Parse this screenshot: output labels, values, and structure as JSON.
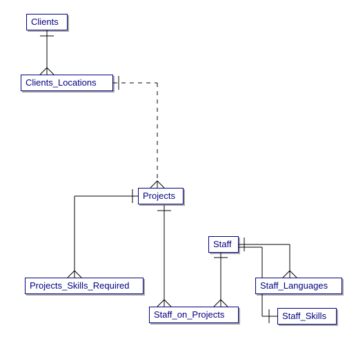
{
  "entities": {
    "clients": {
      "label": "Clients"
    },
    "clients_locations": {
      "label": "Clients_Locations"
    },
    "projects": {
      "label": "Projects"
    },
    "projects_skills_required": {
      "label": "Projects_Skills_Required"
    },
    "staff": {
      "label": "Staff"
    },
    "staff_on_projects": {
      "label": "Staff_on_Projects"
    },
    "staff_languages": {
      "label": "Staff_Languages"
    },
    "staff_skills": {
      "label": "Staff_Skills"
    }
  },
  "relationships": [
    {
      "from": "Clients",
      "to": "Clients_Locations",
      "type": "one-to-many"
    },
    {
      "from": "Clients_Locations",
      "to": "Projects",
      "type": "one-to-many",
      "style": "dashed"
    },
    {
      "from": "Projects",
      "to": "Projects_Skills_Required",
      "type": "one-to-many"
    },
    {
      "from": "Projects",
      "to": "Staff_on_Projects",
      "type": "one-to-many"
    },
    {
      "from": "Staff",
      "to": "Staff_on_Projects",
      "type": "one-to-many"
    },
    {
      "from": "Staff",
      "to": "Staff_Languages",
      "type": "one-to-many"
    },
    {
      "from": "Staff",
      "to": "Staff_Skills",
      "type": "one-to-many"
    }
  ]
}
